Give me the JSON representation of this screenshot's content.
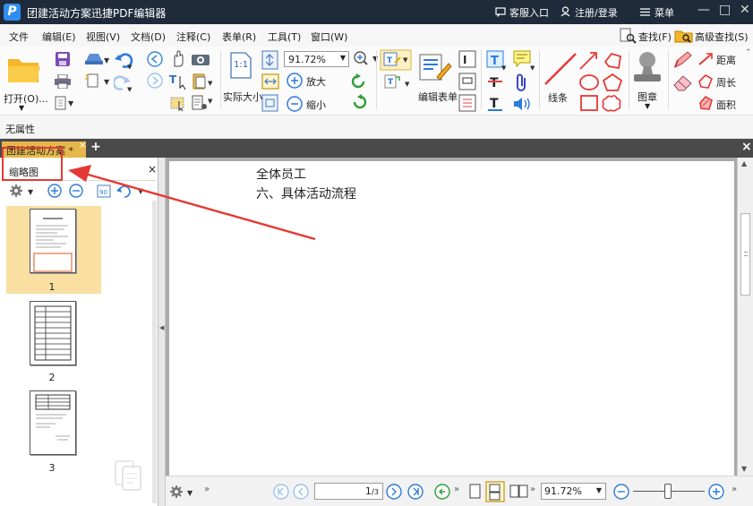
{
  "titlebar": {
    "logo": "P",
    "title": "团建活动方案迅捷PDF编辑器",
    "service": "客服入口",
    "login": "注册/登录",
    "menu": "菜单",
    "minimize": "—",
    "maximize": "□",
    "close": "✕"
  },
  "menubar": {
    "items": [
      "文件",
      "编辑(E)",
      "视图(V)",
      "文档(D)",
      "注释(C)",
      "表单(R)",
      "工具(T)",
      "窗口(W)"
    ],
    "find": "查找(F)",
    "advanced_find": "高级查找(S)"
  },
  "ribbon": {
    "open": "打开(O)...",
    "actual_size": "实际大小",
    "zoom_value": "91.72%",
    "zoom_in": "放大",
    "zoom_out": "缩小",
    "edit_form": "编辑表单",
    "lines": "线条",
    "stamp": "图章",
    "distance": "距离",
    "perimeter": "周长",
    "area": "面积",
    "one_to_one": "1:1"
  },
  "propbar": {
    "text": "无属性"
  },
  "tabs": {
    "doc_tab": "团建活动方案 *",
    "close": "×",
    "add": "+",
    "close_all": "×"
  },
  "thumbnails": {
    "title": "缩略图",
    "close": "×",
    "pages": [
      "1",
      "2",
      "3"
    ]
  },
  "document": {
    "line1": "全体员工",
    "line2": "六、具体活动流程"
  },
  "statusbar": {
    "page_current": "1",
    "page_total": "3",
    "zoom": "91.72%"
  },
  "colors": {
    "titlebar_bg": "#1f2b3a",
    "tab_active": "#e6b84a",
    "annotation_red": "#e53935",
    "accent_blue": "#2e8ef0"
  }
}
